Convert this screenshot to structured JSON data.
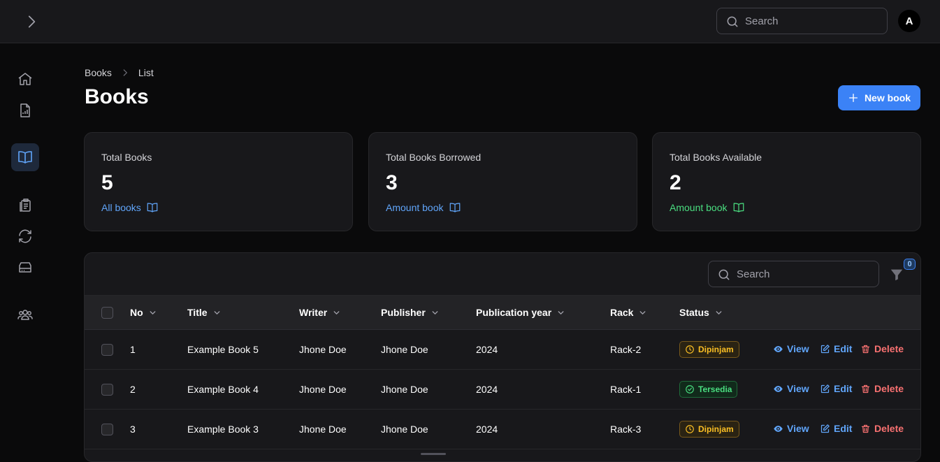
{
  "topbar": {
    "search_placeholder": "Search",
    "avatar_initial": "A"
  },
  "sidebar": {
    "items": [
      "home-icon",
      "report-icon",
      "book-icon",
      "clipboard-icon",
      "refresh-icon",
      "drive-icon",
      "users-icon"
    ],
    "active": "book-icon"
  },
  "breadcrumb": {
    "root": "Books",
    "current": "List"
  },
  "page": {
    "title": "Books",
    "new_button": "New book"
  },
  "stats": [
    {
      "label": "Total Books",
      "value": "5",
      "desc": "All books",
      "color": "#60a5fa"
    },
    {
      "label": "Total Books Borrowed",
      "value": "3",
      "desc": "Amount book",
      "color": "#60a5fa"
    },
    {
      "label": "Total Books Available",
      "value": "2",
      "desc": "Amount book",
      "color": "#4ade80"
    }
  ],
  "table": {
    "search_placeholder": "Search",
    "filter_count": "0",
    "columns": [
      "No",
      "Title",
      "Writer",
      "Publisher",
      "Publication year",
      "Rack",
      "Status"
    ],
    "rows": [
      {
        "no": "1",
        "title": "Example Book 5",
        "writer": "Jhone Doe",
        "publisher": "Jhone Doe",
        "year": "2024",
        "rack": "Rack-2",
        "status": "Dipinjam",
        "status_type": "warning"
      },
      {
        "no": "2",
        "title": "Example Book 4",
        "writer": "Jhone Doe",
        "publisher": "Jhone Doe",
        "year": "2024",
        "rack": "Rack-1",
        "status": "Tersedia",
        "status_type": "success"
      },
      {
        "no": "3",
        "title": "Example Book 3",
        "writer": "Jhone Doe",
        "publisher": "Jhone Doe",
        "year": "2024",
        "rack": "Rack-3",
        "status": "Dipinjam",
        "status_type": "warning"
      }
    ],
    "actions": {
      "view": "View",
      "edit": "Edit",
      "delete": "Delete"
    }
  },
  "colors": {
    "accent": "#3b82f6",
    "warning": "#fbbf24",
    "success": "#4ade80",
    "danger": "#f87171"
  }
}
